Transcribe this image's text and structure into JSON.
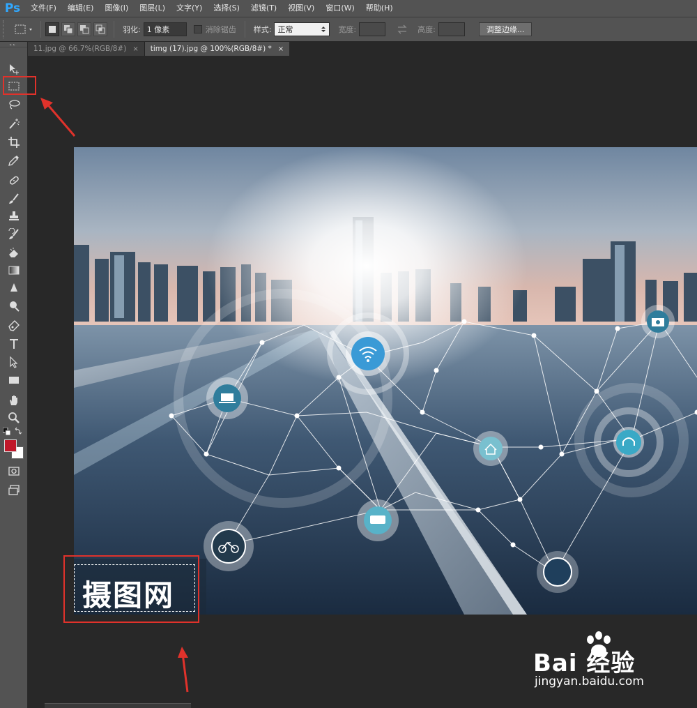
{
  "app": {
    "logo": "Ps"
  },
  "menu": [
    "文件(F)",
    "编辑(E)",
    "图像(I)",
    "图层(L)",
    "文字(Y)",
    "选择(S)",
    "滤镜(T)",
    "视图(V)",
    "窗口(W)",
    "帮助(H)"
  ],
  "options": {
    "feather_label": "羽化:",
    "feather_value": "1 像素",
    "antialias_label": "消除锯齿",
    "style_label": "样式:",
    "style_value": "正常",
    "width_label": "宽度:",
    "height_label": "高度:",
    "refine_edge_button": "调整边缘..."
  },
  "tabs": [
    {
      "label": "11.jpg @ 66.7%(RGB/8#)",
      "close": "×"
    },
    {
      "label": "timg (17).jpg @ 100%(RGB/8#) *",
      "close": "×"
    }
  ],
  "image": {
    "watermark": "摄图网"
  },
  "colors": {
    "foreground": "#c0182a",
    "background": "#ffffff",
    "annotation": "#e0322b"
  },
  "baidu": {
    "logo": "Bai  经验",
    "url": "jingyan.baidu.com"
  }
}
